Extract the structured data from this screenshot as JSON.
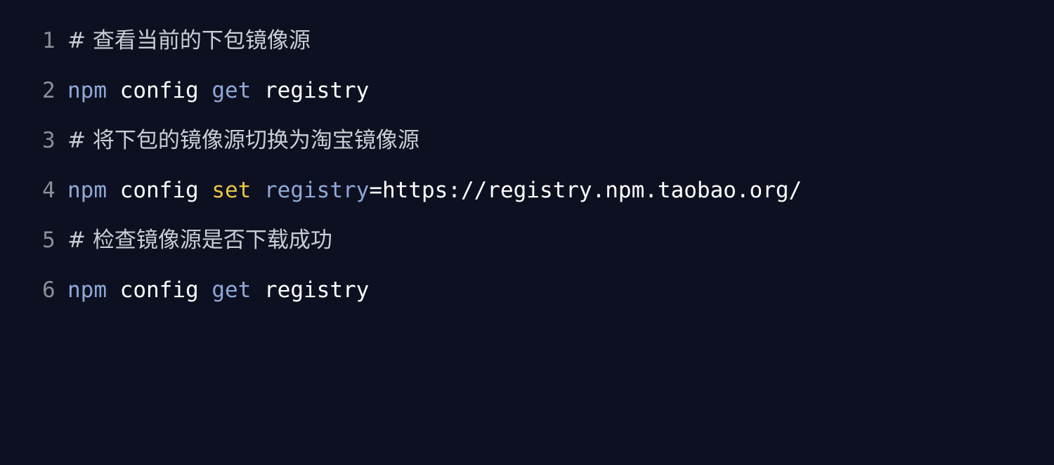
{
  "code": {
    "lines": [
      {
        "number": "1",
        "comment": "# 查看当前的下包镜像源"
      },
      {
        "number": "2",
        "cmd": "npm",
        "sub": "config",
        "op": "get",
        "arg": "registry"
      },
      {
        "number": "3",
        "comment": "# 将下包的镜像源切换为淘宝镜像源"
      },
      {
        "number": "4",
        "cmd": "npm",
        "sub": "config",
        "op": "set",
        "arg": "registry",
        "value": "=https://registry.npm.taobao.org/"
      },
      {
        "number": "5",
        "comment": "# 检查镜像源是否下载成功"
      },
      {
        "number": "6",
        "cmd": "npm",
        "sub": "config",
        "op": "get",
        "arg": "registry"
      }
    ]
  },
  "colors": {
    "background": "#0d1020",
    "line_number": "#8b8f98",
    "comment": "#c9cdd4",
    "command": "#8fa8d9",
    "plain": "#ffffff",
    "keyword_set": "#e8c547"
  }
}
